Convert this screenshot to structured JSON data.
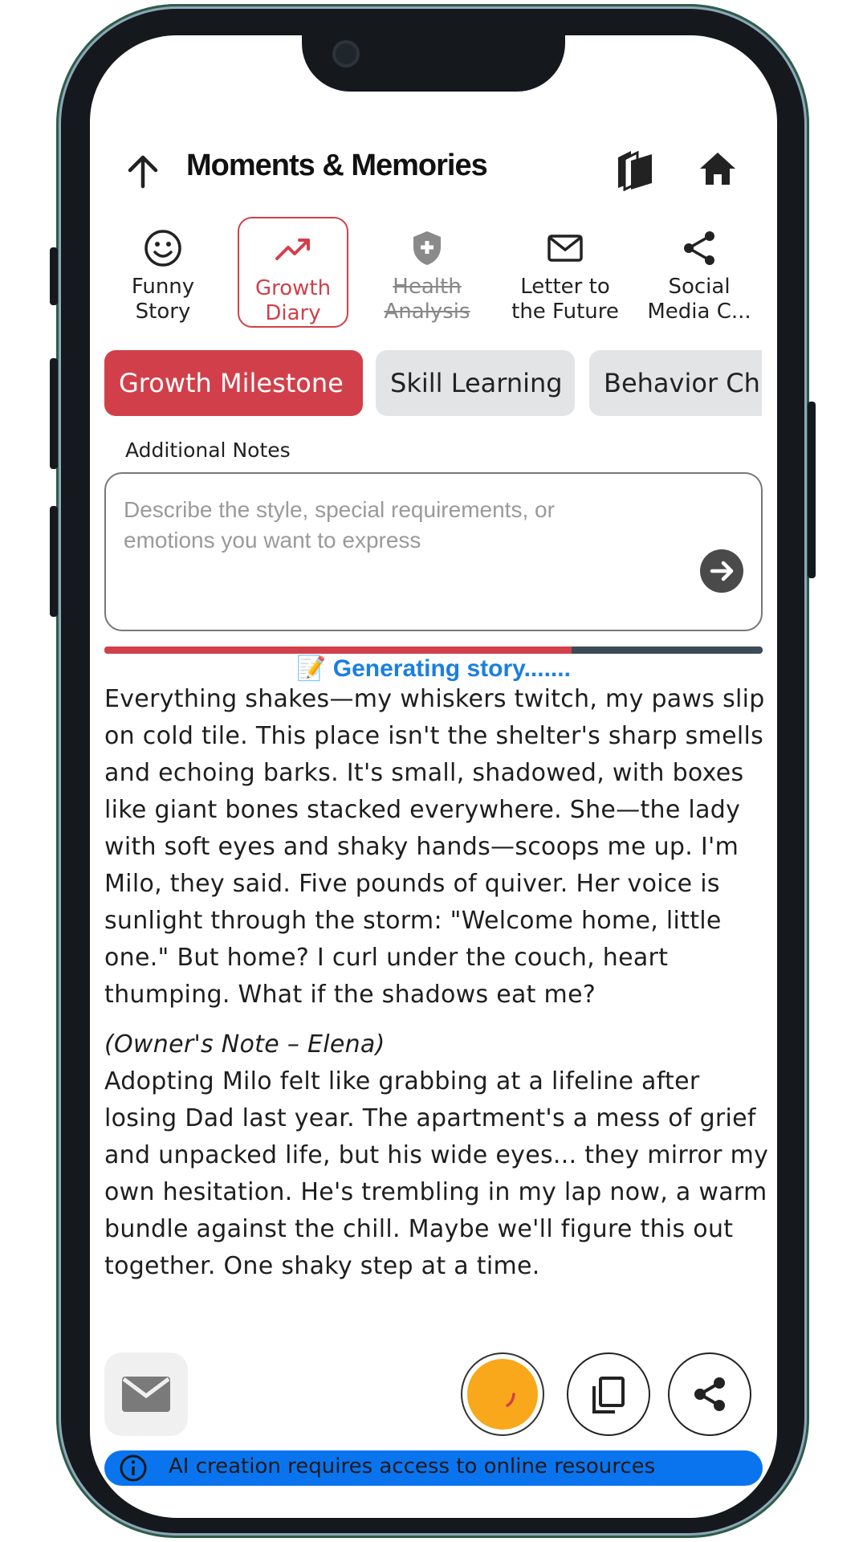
{
  "header": {
    "title": "Moments & Memories",
    "back_icon": "arrow-up-icon",
    "library_icon": "book-stack-icon",
    "home_icon": "home-icon"
  },
  "story_types": [
    {
      "label": "Funny\nStory",
      "icon": "smiley-icon",
      "state": "normal"
    },
    {
      "label": "Growth\nDiary",
      "icon": "trending-up-icon",
      "state": "selected"
    },
    {
      "label": "Health\nAnalysis",
      "icon": "shield-plus-icon",
      "state": "disabled"
    },
    {
      "label": "Letter to\nthe Future",
      "icon": "envelope-icon",
      "state": "normal"
    },
    {
      "label": "Social\nMedia C...",
      "icon": "share-icon",
      "state": "normal"
    }
  ],
  "subtopics": [
    {
      "label": "Growth Milestone",
      "selected": true
    },
    {
      "label": "Skill Learning",
      "selected": false
    },
    {
      "label": "Behavior Ch",
      "selected": false
    }
  ],
  "notes": {
    "label": "Additional Notes",
    "placeholder": "Describe the style, special requirements, or emotions you want to express",
    "value": ""
  },
  "progress": {
    "fraction": 0.71
  },
  "status": {
    "text": "📝 Generating story.......",
    "color": "#1a7fe0"
  },
  "story": {
    "paragraph1": "Everything shakes—my whiskers twitch, my paws slip on cold tile. This place isn't the shelter's sharp smells and echoing barks. It's small, shadowed, with boxes like giant bones stacked everywhere. She—the lady with soft eyes and shaky hands—scoops me up. I'm Milo, they said. Five pounds of quiver. Her voice is sunlight through the storm: \"Welcome home, little one.\" But home? I curl under the couch, heart thumping. What if the shadows eat me?",
    "note_heading": "(Owner's Note – Elena)",
    "paragraph2": "Adopting Milo felt like grabbing at a lifeline after losing Dad last year. The apartment's a mess of grief and unpacked life, but his wide eyes... they mirror my own hesitation. He's trembling in my lap now, a warm bundle against the chill. Maybe we'll figure this out together. One shaky step at a time."
  },
  "actions": {
    "mail_icon": "mail-icon",
    "generate_icon": "spinner-icon",
    "copy_icon": "copy-icon",
    "share_icon": "share-icon"
  },
  "info_bar": {
    "text": "AI creation requires access to online resources",
    "icon": "info-icon"
  },
  "colors": {
    "accent": "#d1404a",
    "info": "#0a74ef",
    "generate": "#f8a81a"
  }
}
